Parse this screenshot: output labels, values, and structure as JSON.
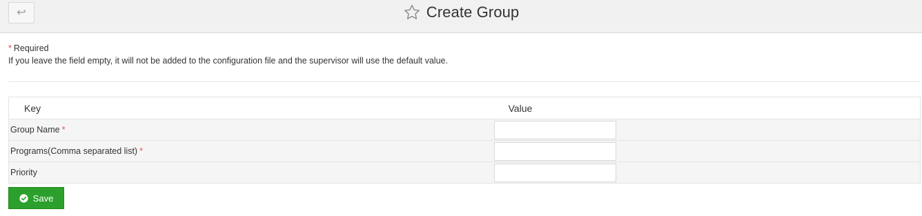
{
  "header": {
    "back_button_glyph": "↩",
    "title": "Create Group",
    "icons": {
      "back": "back-arrow-icon",
      "favorite": "star-outline-icon"
    }
  },
  "notice": {
    "required_marker": "*",
    "required_label": "Required",
    "hint": "If you leave the field empty, it will not be added to the configuration file and the supervisor will use the default value."
  },
  "table": {
    "columns": [
      "Key",
      "Value"
    ],
    "rows": [
      {
        "key": "Group Name",
        "required": "*",
        "value": ""
      },
      {
        "key": "Programs(Comma separated list)",
        "required": "*",
        "value": ""
      },
      {
        "key": "Priority",
        "required": "",
        "value": ""
      }
    ]
  },
  "actions": {
    "save_label": "Save",
    "save_icon": "check-circle-icon"
  },
  "colors": {
    "topbar_bg": "#f1f1f1",
    "required_red": "#d9534f",
    "save_green": "#2ca02c",
    "row_bg": "#f5f5f5"
  }
}
